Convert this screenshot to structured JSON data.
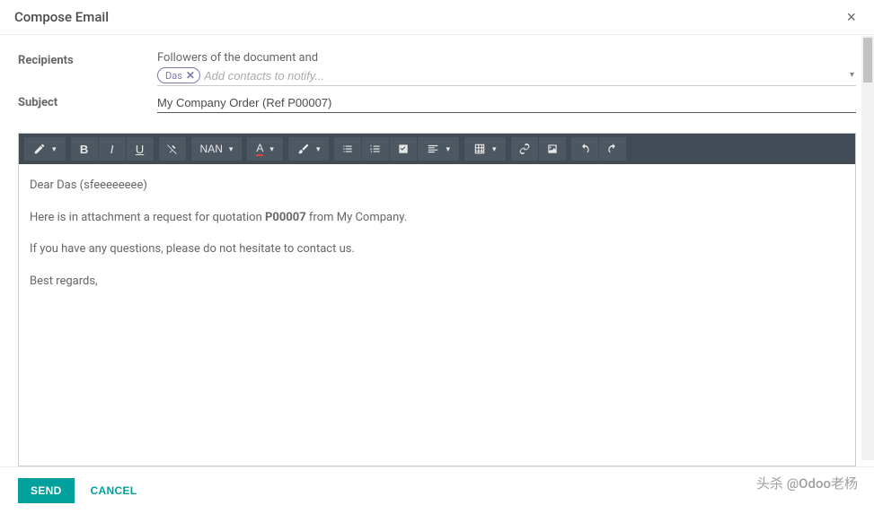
{
  "header": {
    "title": "Compose Email"
  },
  "form": {
    "recipients_label": "Recipients",
    "followers_text": "Followers of the document and",
    "tag_name": "Das",
    "contacts_placeholder": "Add contacts to notify...",
    "subject_label": "Subject",
    "subject_value": "My Company Order (Ref P00007)"
  },
  "toolbar": {
    "size_label": "NAN"
  },
  "body": {
    "greeting": "Dear Das (sfeeeeeeee)",
    "line1_a": "Here is in attachment a request for quotation ",
    "line1_bold": "P00007",
    "line1_b": " from My Company.",
    "line2": "If you have any questions, please do not hesitate to contact us.",
    "signoff": "Best regards,"
  },
  "footer": {
    "send": "SEND",
    "cancel": "CANCEL"
  },
  "watermark": "头杀 @Odoo老杨"
}
